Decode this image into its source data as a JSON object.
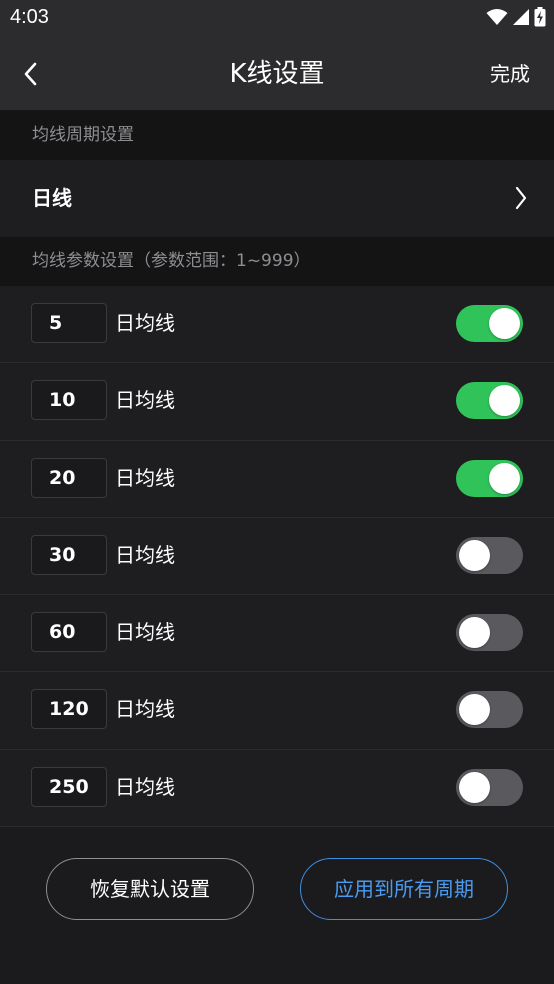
{
  "status_bar": {
    "time": "4:03",
    "icons": [
      "wifi-icon",
      "signal-icon",
      "battery-charging-icon"
    ]
  },
  "nav": {
    "back_icon": "chevron-left-icon",
    "title": "K线设置",
    "done_label": "完成"
  },
  "period_section": {
    "header": "均线周期设置",
    "value": "日线",
    "chevron_icon": "chevron-right-icon"
  },
  "params_section": {
    "header": "均线参数设置（参数范围：1~999）"
  },
  "ma_rows": [
    {
      "period": "5",
      "label": "日均线",
      "enabled": true
    },
    {
      "period": "10",
      "label": "日均线",
      "enabled": true
    },
    {
      "period": "20",
      "label": "日均线",
      "enabled": true
    },
    {
      "period": "30",
      "label": "日均线",
      "enabled": false
    },
    {
      "period": "60",
      "label": "日均线",
      "enabled": false
    },
    {
      "period": "120",
      "label": "日均线",
      "enabled": false
    },
    {
      "period": "250",
      "label": "日均线",
      "enabled": false
    }
  ],
  "actions": {
    "reset_label": "恢复默认设置",
    "apply_label": "应用到所有周期"
  },
  "colors": {
    "toggle_on": "#2fc35a",
    "toggle_off": "#5a5a5e",
    "accent_blue": "#4a9bf0",
    "background": "#1b1b1d"
  }
}
